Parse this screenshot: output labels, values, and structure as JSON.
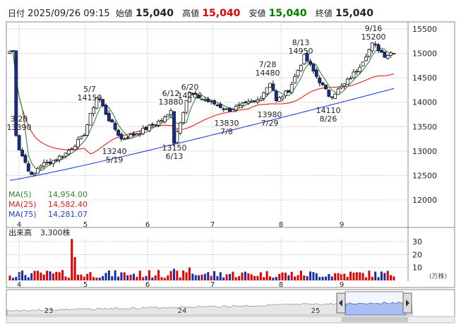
{
  "header": {
    "date_label": "日付",
    "datetime": "2025/09/26 09:15",
    "open_label": "始値",
    "open": "15,040",
    "high_label": "高値",
    "high": "15,040",
    "low_label": "安値",
    "low": "15,040",
    "close_label": "終値",
    "close": "15,040",
    "high_color": "#e00000",
    "low_color": "#008000"
  },
  "legend": {
    "ma5_label": "MA(5)",
    "ma5_value": "14,954.00",
    "ma25_label": "MA(25)",
    "ma25_value": "14,582.40",
    "ma75_label": "MA(75)",
    "ma75_value": "14,281.07",
    "ma5_color": "#2e8b2e",
    "ma25_color": "#e02020",
    "ma75_color": "#2040e0"
  },
  "volume_panel": {
    "title": "出来高",
    "value": "3,300株",
    "unit_label": "(万株)",
    "y_ticks": [
      "30",
      "20",
      "10"
    ]
  },
  "navigator": {
    "year_labels": [
      "23",
      "24",
      "25"
    ]
  },
  "chart_data": {
    "type": "candlestick",
    "price_axis": {
      "ticks": [
        "15500",
        "15000",
        "14500",
        "14000",
        "13500",
        "13000",
        "12500",
        "12000"
      ],
      "ylim": [
        11800,
        15700
      ]
    },
    "month_labels": [
      "4",
      "5",
      "6",
      "7",
      "8",
      "9"
    ],
    "annotations": [
      {
        "date": "3/28",
        "value": 13390,
        "kind": "high"
      },
      {
        "date": "5/7",
        "value": 14150,
        "kind": "high"
      },
      {
        "date": "5/19",
        "value": 13240,
        "kind": "low"
      },
      {
        "date": "6/12",
        "value": 13880,
        "kind": "high"
      },
      {
        "date": "6/13",
        "value": 13150,
        "kind": "low"
      },
      {
        "date": "6/20",
        "value": 14200,
        "kind": "high"
      },
      {
        "date": "7/8",
        "value": 13830,
        "kind": "low"
      },
      {
        "date": "7/28",
        "value": 14480,
        "kind": "high"
      },
      {
        "date": "7/29",
        "value": 13980,
        "kind": "low"
      },
      {
        "date": "8/13",
        "value": 14950,
        "kind": "high"
      },
      {
        "date": "8/26",
        "value": 14110,
        "kind": "low"
      },
      {
        "date": "9/16",
        "value": 15200,
        "kind": "high"
      }
    ],
    "ma5_last": 14954.0,
    "ma25_last": 14582.4,
    "ma75_last": 14281.07,
    "volume_ylim": [
      0,
      38
    ]
  }
}
